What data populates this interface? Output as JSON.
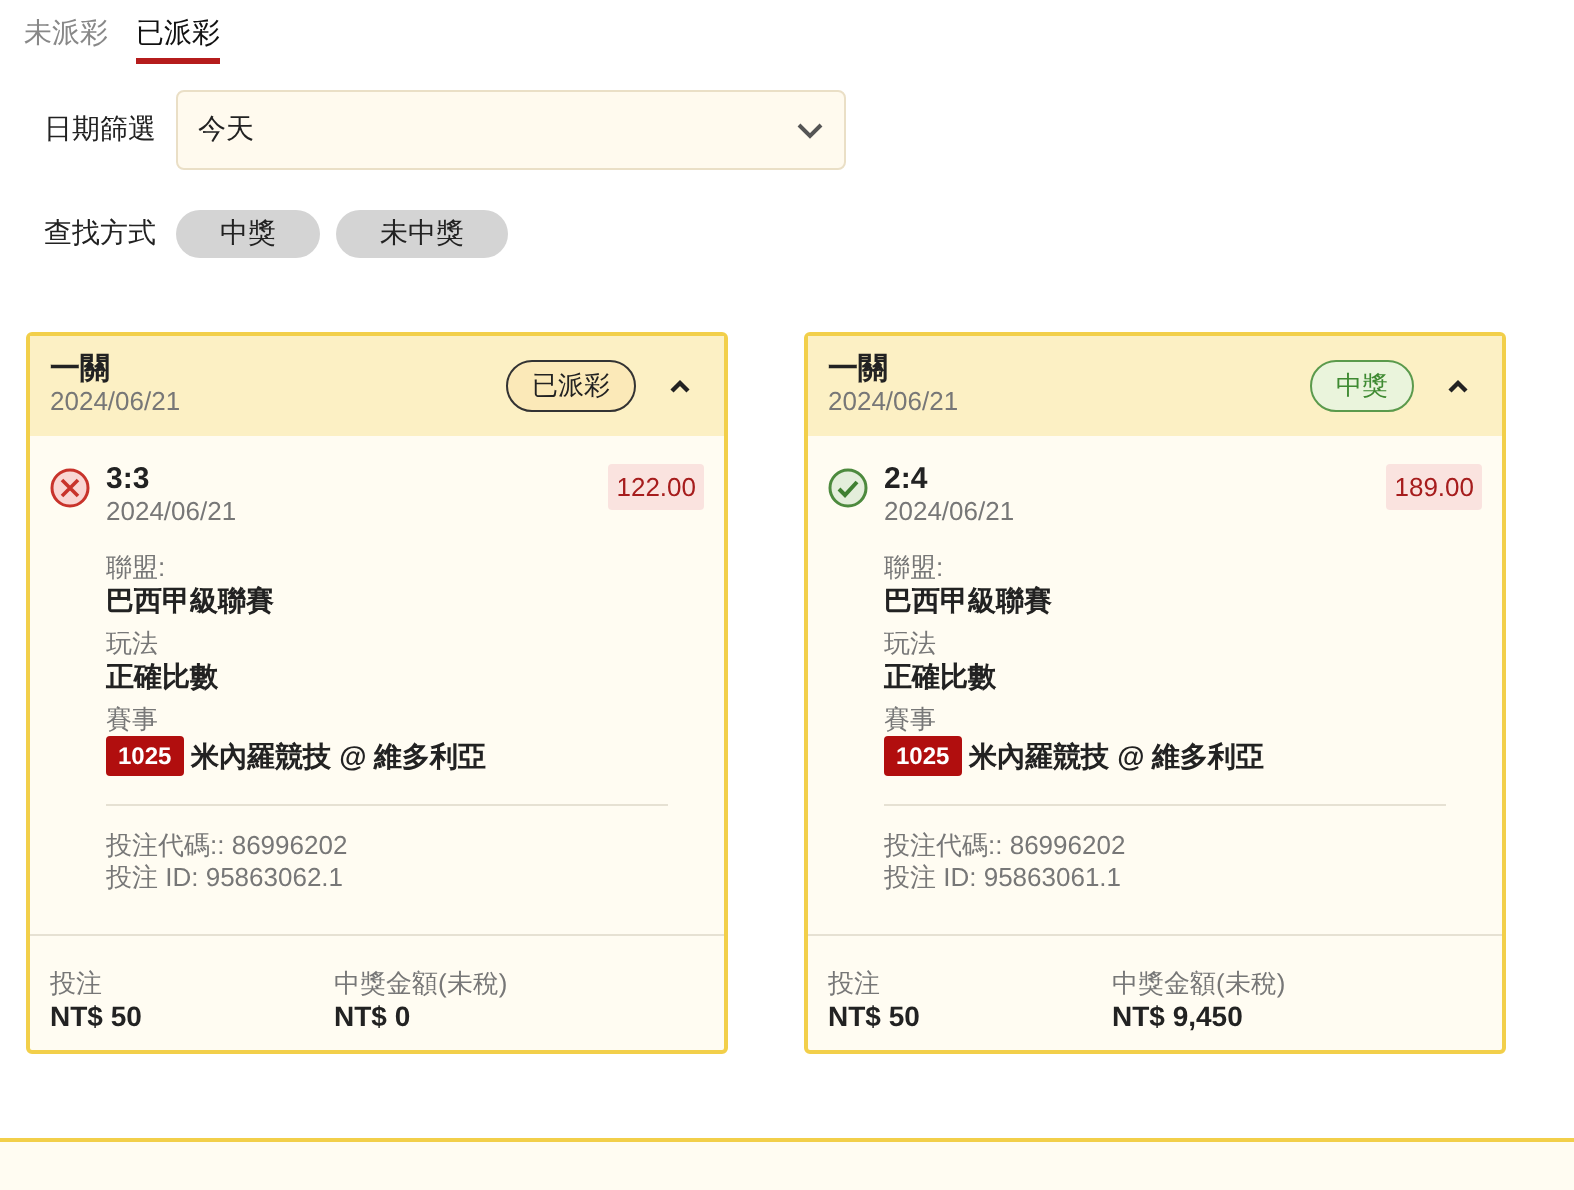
{
  "tabs": [
    {
      "label": "未派彩",
      "selected": false
    },
    {
      "label": "已派彩",
      "selected": true
    }
  ],
  "date_filter": {
    "label": "日期篩選",
    "value": "今天"
  },
  "search_mode": {
    "label": "查找方式",
    "options": [
      "中獎",
      "未中獎"
    ]
  },
  "bets": [
    {
      "title": "一關",
      "date": "2024/06/21",
      "status": {
        "kind": "paid",
        "label": "已派彩"
      },
      "expanded": true,
      "won": false,
      "score": "3:3",
      "match_date": "2024/06/21",
      "amount": "122.00",
      "league_label": "聯盟:",
      "league": "巴西甲級聯賽",
      "play_label": "玩法",
      "play": "正確比數",
      "event_label": "賽事",
      "event_code": "1025",
      "event": "米內羅競技 @ 維多利亞",
      "bet_code": "投注代碼:: 86996202",
      "bet_id": "投注 ID: 95863062.1",
      "stake_label": "投注",
      "stake": "NT$ 50",
      "payout_label": "中獎金額(未稅)",
      "payout": "NT$ 0"
    },
    {
      "title": "一關",
      "date": "2024/06/21",
      "status": {
        "kind": "won",
        "label": "中獎"
      },
      "expanded": true,
      "won": true,
      "score": "2:4",
      "match_date": "2024/06/21",
      "amount": "189.00",
      "league_label": "聯盟:",
      "league": "巴西甲級聯賽",
      "play_label": "玩法",
      "play": "正確比數",
      "event_label": "賽事",
      "event_code": "1025",
      "event": "米內羅競技 @ 維多利亞",
      "bet_code": "投注代碼:: 86996202",
      "bet_id": "投注 ID: 95863061.1",
      "stake_label": "投注",
      "stake": "NT$ 50",
      "payout_label": "中獎金額(未稅)",
      "payout": "NT$ 9,450"
    }
  ]
}
